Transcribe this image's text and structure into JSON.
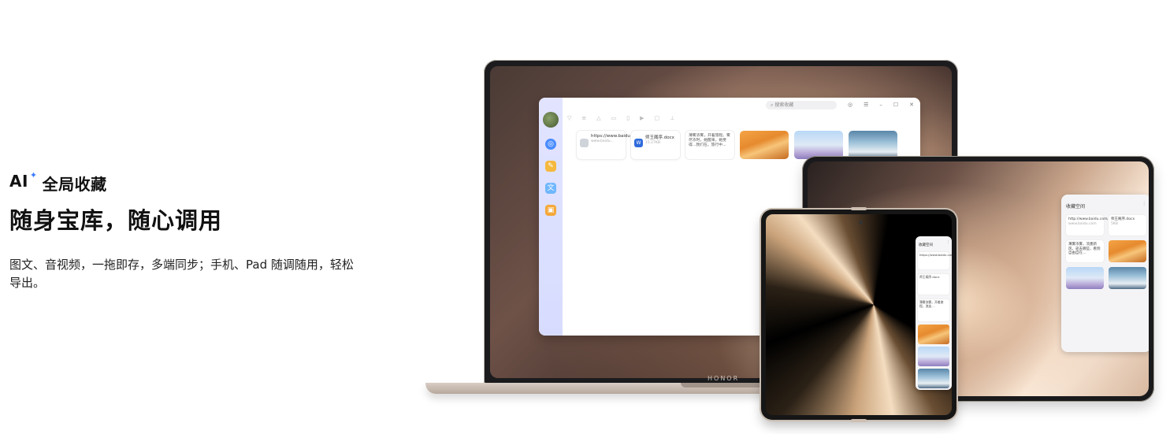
{
  "hero": {
    "eyebrow_prefix": "AI",
    "sparkle": "✦",
    "eyebrow": "全局收藏",
    "headline": "随身宝库，随心调用",
    "description": "图文、音视频，一拖即存，多端同步；手机、Pad 随调随用，轻松导出。"
  },
  "laptop": {
    "brand": "HONOR",
    "search_placeholder": "搜索收藏",
    "toolbar_icons": [
      "filter-icon",
      "text-icon",
      "image-icon",
      "file-icon",
      "doc-icon",
      "video-icon",
      "media-icon",
      "share-icon"
    ],
    "window_controls": [
      "◎",
      "☰",
      "–",
      "☐",
      "✕"
    ],
    "cards": [
      {
        "type": "link",
        "title": "https://www.baidu.co...",
        "sub": "www.baidu..."
      },
      {
        "type": "word",
        "title": "师王阁序.docx",
        "sub": "15.27KB"
      },
      {
        "type": "text",
        "title": "薄雾浓雾，开着旅程。雾尽浓时，她醒来，她觉得...我们在，旅行中..."
      }
    ]
  },
  "tablet": {
    "panel_title": "收藏空间",
    "cards": [
      {
        "title": "http://www.baidu.com/...",
        "sub": "www.baidu.com"
      },
      {
        "title": "师王阁序.docx",
        "sub": "5KB"
      },
      {
        "title": "薄雾浓雾，流墨新风，逝去哪些，看到自由自在..."
      }
    ]
  },
  "phone": {
    "panel_title": "收藏空间",
    "cards": [
      {
        "title": "https://www.baidu.com/..."
      },
      {
        "title": "师王阁序.docx"
      },
      {
        "title": "薄雾浓雾，开着旅程，流连..."
      }
    ]
  }
}
